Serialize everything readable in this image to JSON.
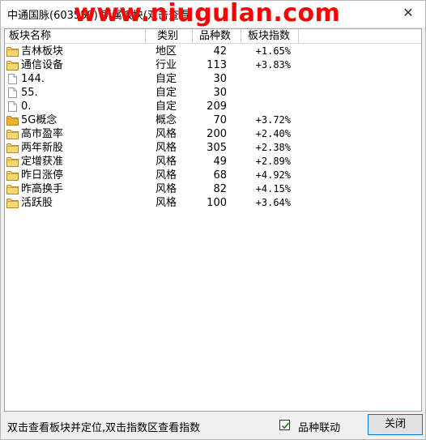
{
  "window": {
    "title": "中通国脉(603559) 所属板块(双击查看",
    "watermark": "www.niugulan.com",
    "close_glyph": "✕"
  },
  "table": {
    "columns": [
      "板块名称",
      "类别",
      "品种数",
      "板块指数"
    ],
    "rows": [
      {
        "icon": "folder-icon",
        "name": "吉林板块",
        "type": "地区",
        "count": "42",
        "index": "+1.65%"
      },
      {
        "icon": "folder-icon",
        "name": "通信设备",
        "type": "行业",
        "count": "113",
        "index": "+3.83%"
      },
      {
        "icon": "document-icon",
        "name": "144.",
        "type": "自定",
        "count": "30",
        "index": ""
      },
      {
        "icon": "document-icon",
        "name": "55.",
        "type": "自定",
        "count": "30",
        "index": ""
      },
      {
        "icon": "document-icon",
        "name": "0.",
        "type": "自定",
        "count": "209",
        "index": ""
      },
      {
        "icon": "folder-orange-icon",
        "name": "5G概念",
        "type": "概念",
        "count": "70",
        "index": "+3.72%"
      },
      {
        "icon": "folder-icon",
        "name": "高市盈率",
        "type": "风格",
        "count": "200",
        "index": "+2.40%"
      },
      {
        "icon": "folder-icon",
        "name": "两年新股",
        "type": "风格",
        "count": "305",
        "index": "+2.38%"
      },
      {
        "icon": "folder-icon",
        "name": "定增获准",
        "type": "风格",
        "count": "49",
        "index": "+2.89%"
      },
      {
        "icon": "folder-icon",
        "name": "昨日涨停",
        "type": "风格",
        "count": "68",
        "index": "+4.92%"
      },
      {
        "icon": "folder-icon",
        "name": "昨高换手",
        "type": "风格",
        "count": "82",
        "index": "+4.15%"
      },
      {
        "icon": "folder-icon",
        "name": "活跃股",
        "type": "风格",
        "count": "100",
        "index": "+3.64%"
      }
    ]
  },
  "footer": {
    "hint": "双击查看板块并定位,双击指数区查看指数",
    "checkbox_label": "品种联动",
    "checkbox_checked": true,
    "close_button": "关闭"
  },
  "colors": {
    "watermark": "#ff0000",
    "folder": "#f7d675",
    "folder_orange": "#f0b028",
    "check": "#2e7d32"
  }
}
